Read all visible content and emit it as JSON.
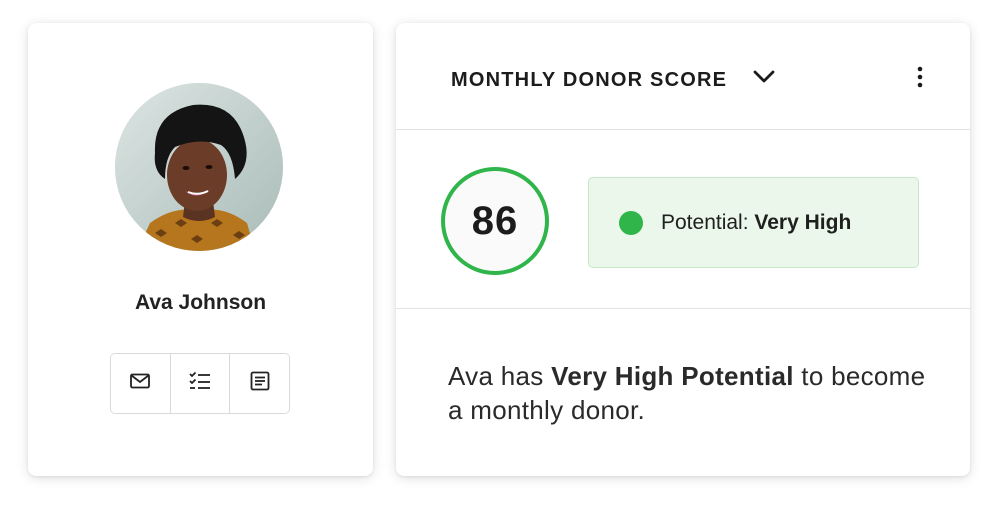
{
  "profile": {
    "name": "Ava Johnson",
    "avatar_alt": "Ava Johnson portrait",
    "actions": [
      {
        "icon": "mail-icon",
        "label": "Email"
      },
      {
        "icon": "task-list-icon",
        "label": "Tasks"
      },
      {
        "icon": "notes-icon",
        "label": "Notes"
      }
    ]
  },
  "score_card": {
    "title": "MONTHLY DONOR SCORE",
    "dropdown_icon": "chevron-down-icon",
    "menu_icon": "more-vertical-icon",
    "score": "86",
    "potential_label": "Potential:",
    "potential_value": "Very High",
    "summary": {
      "prefix": "Ava has ",
      "highlight": "Very High Potential",
      "suffix": " to become a monthly donor."
    },
    "colors": {
      "score_ring": "#2fb54a",
      "badge_background": "#eaf7ea",
      "badge_border": "#c4e7c6",
      "status_dot": "#2fb54a"
    }
  }
}
